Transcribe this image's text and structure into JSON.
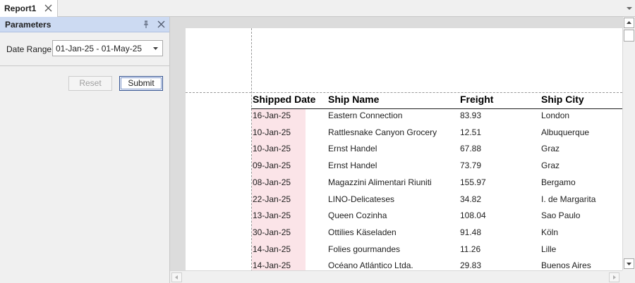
{
  "tabs": [
    {
      "label": "Report1",
      "icon": "close-icon"
    }
  ],
  "tabstrip": {
    "menu_icon": "chevron-down-icon"
  },
  "parameters": {
    "title": "Parameters",
    "pin_icon": "pin-icon",
    "close_icon": "close-icon",
    "date_range": {
      "label": "Date Range",
      "value": "01-Jan-25 - 01-May-25",
      "icon": "chevron-down-icon"
    },
    "reset_label": "Reset",
    "submit_label": "Submit"
  },
  "report": {
    "columns": [
      "Shipped Date",
      "Ship Name",
      "Freight",
      "Ship City"
    ],
    "rows": [
      [
        "16-Jan-25",
        "Eastern Connection",
        "83.93",
        "London"
      ],
      [
        "10-Jan-25",
        "Rattlesnake Canyon Grocery",
        "12.51",
        "Albuquerque"
      ],
      [
        "10-Jan-25",
        "Ernst Handel",
        "67.88",
        "Graz"
      ],
      [
        "09-Jan-25",
        "Ernst Handel",
        "73.79",
        "Graz"
      ],
      [
        "08-Jan-25",
        "Magazzini Alimentari Riuniti",
        "155.97",
        "Bergamo"
      ],
      [
        "22-Jan-25",
        "LINO-Delicateses",
        "34.82",
        "I. de Margarita"
      ],
      [
        "13-Jan-25",
        "Queen Cozinha",
        "108.04",
        "Sao Paulo"
      ],
      [
        "30-Jan-25",
        "Ottilies Käseladen",
        "91.48",
        "Köln"
      ],
      [
        "14-Jan-25",
        "Folies gourmandes",
        "11.26",
        "Lille"
      ],
      [
        "14-Jan-25",
        "Océano Atlántico Ltda.",
        "29.83",
        "Buenos Aires"
      ]
    ]
  },
  "colors": {
    "panel_header": "#ccdaf2",
    "date_highlight": "#fbe4e8",
    "submit_border": "#2f4f8f"
  }
}
